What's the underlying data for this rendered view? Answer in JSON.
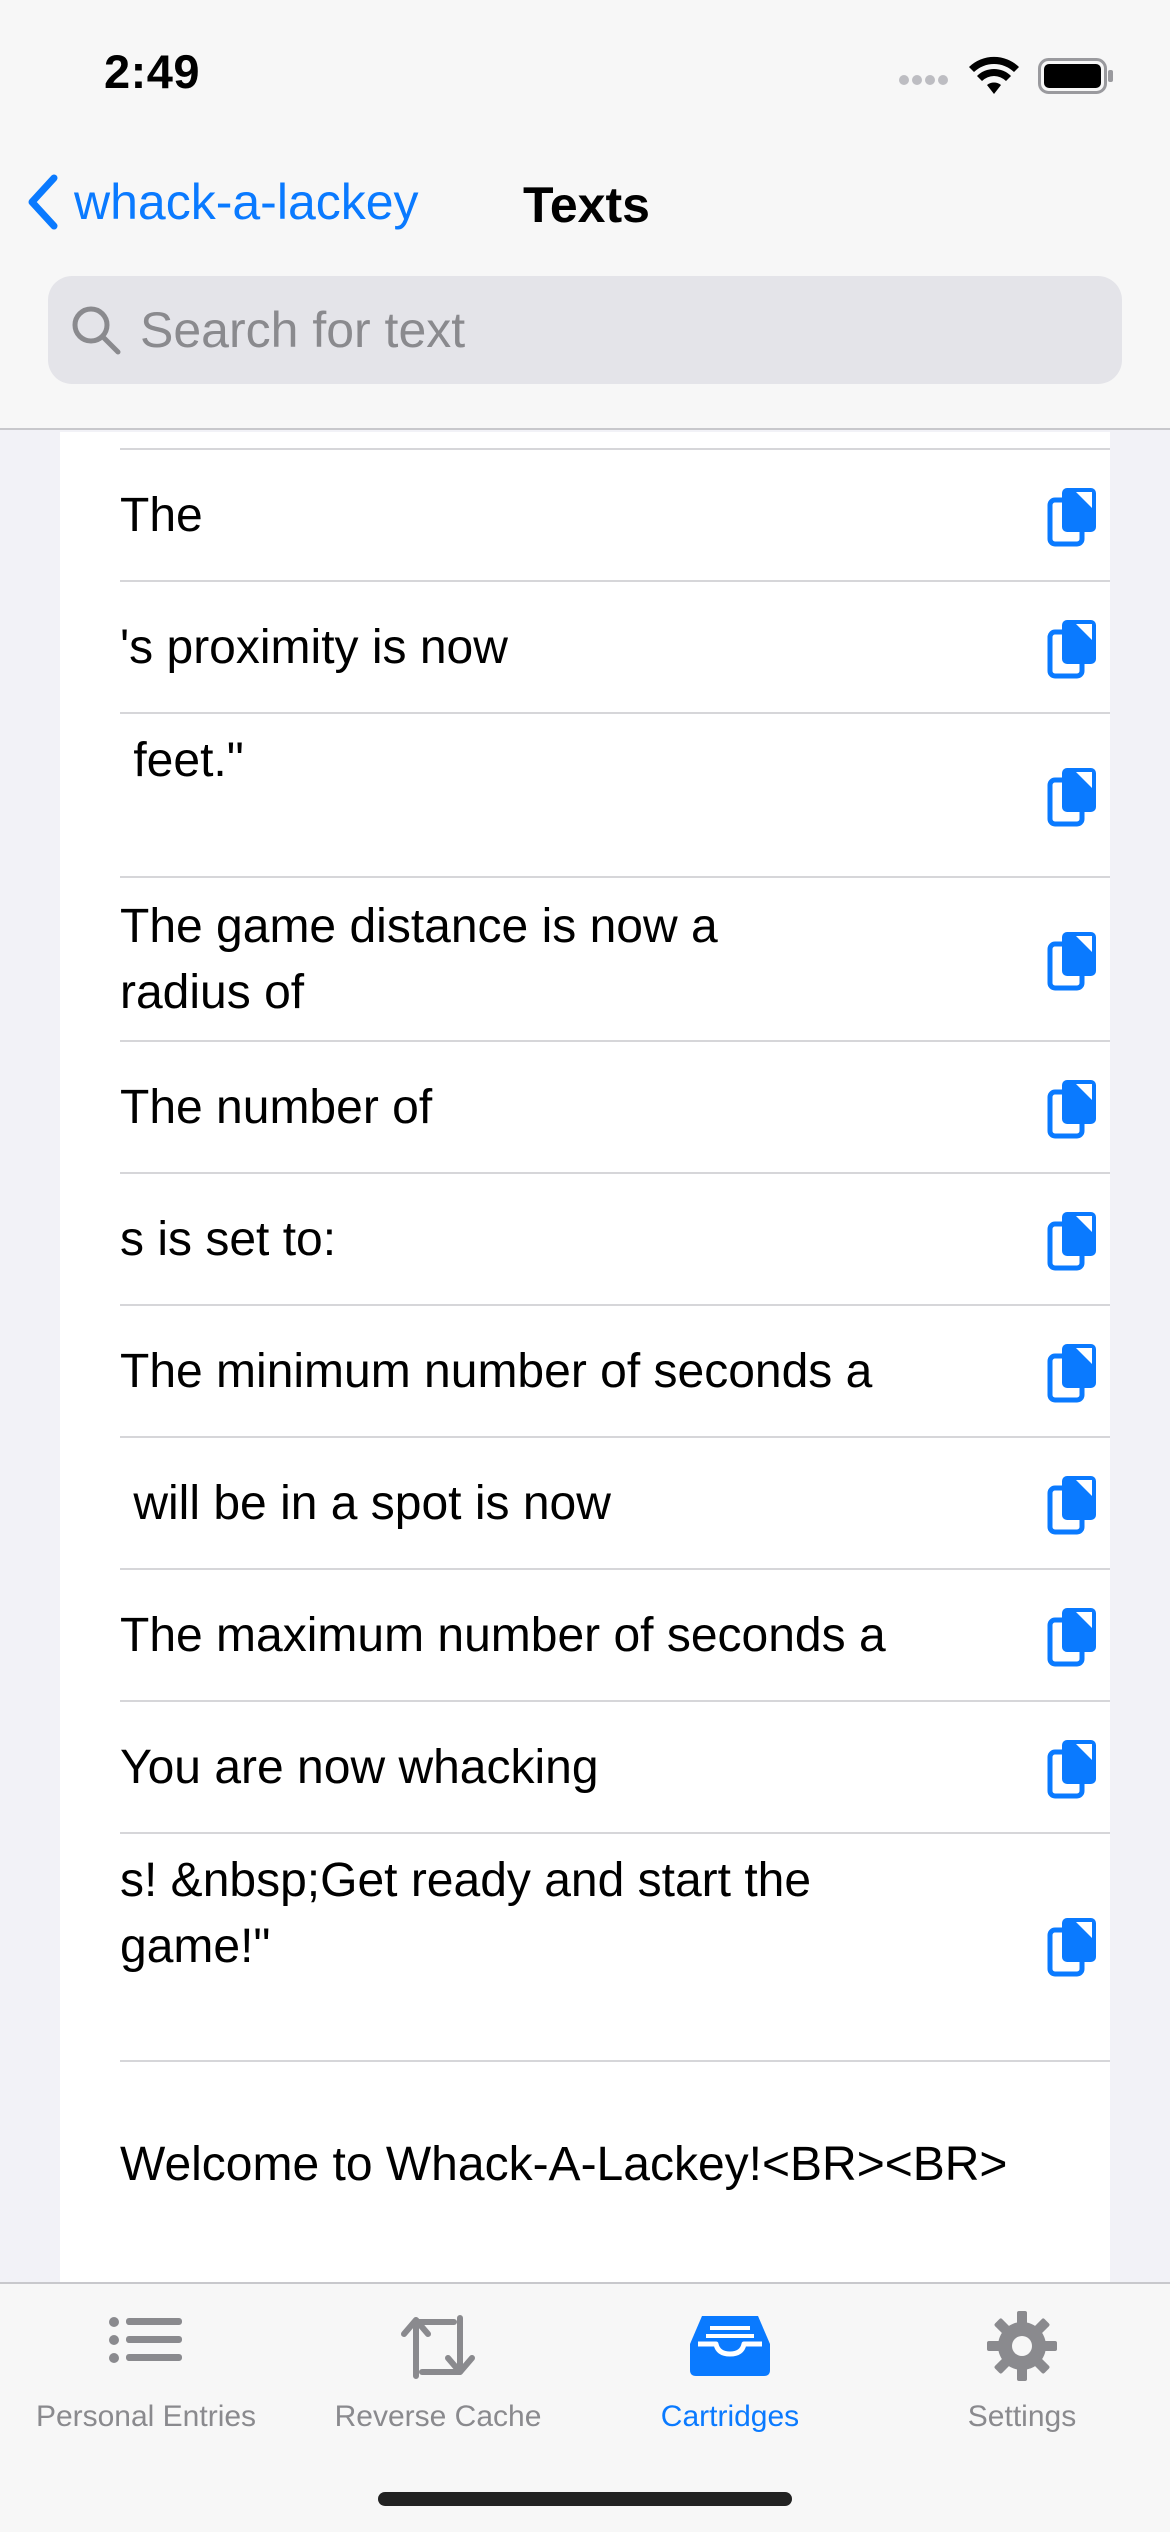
{
  "status_bar": {
    "time": "2:49"
  },
  "nav": {
    "back_label": "whack-a-lackey",
    "title": "Texts"
  },
  "search": {
    "placeholder": "Search for text"
  },
  "rows": [
    {
      "text": "The"
    },
    {
      "text": "'s proximity is now"
    },
    {
      "text": " feet.\""
    },
    {
      "text": "The game distance is now a radius of"
    },
    {
      "text": "The number of"
    },
    {
      "text": "s is set to:"
    },
    {
      "text": "The minimum number of seconds a"
    },
    {
      "text": " will be in a spot is now"
    },
    {
      "text": "The maximum number of seconds a"
    },
    {
      "text": "You are now whacking"
    },
    {
      "text": "s! &nbsp;Get ready and start the game!\""
    }
  ],
  "welcome_text": "Welcome to Whack-A-Lackey!<BR><BR>",
  "tabs": [
    {
      "label": "Personal Entries",
      "icon": "list-icon"
    },
    {
      "label": "Reverse Cache",
      "icon": "reverse-cache-icon"
    },
    {
      "label": "Cartridges",
      "icon": "tray-icon",
      "active": true
    },
    {
      "label": "Settings",
      "icon": "gear-icon"
    }
  ],
  "colors": {
    "accent": "#0a7aff",
    "background": "#f2f2f7",
    "card": "#ffffff",
    "tab_inactive": "#8a8a8e"
  }
}
